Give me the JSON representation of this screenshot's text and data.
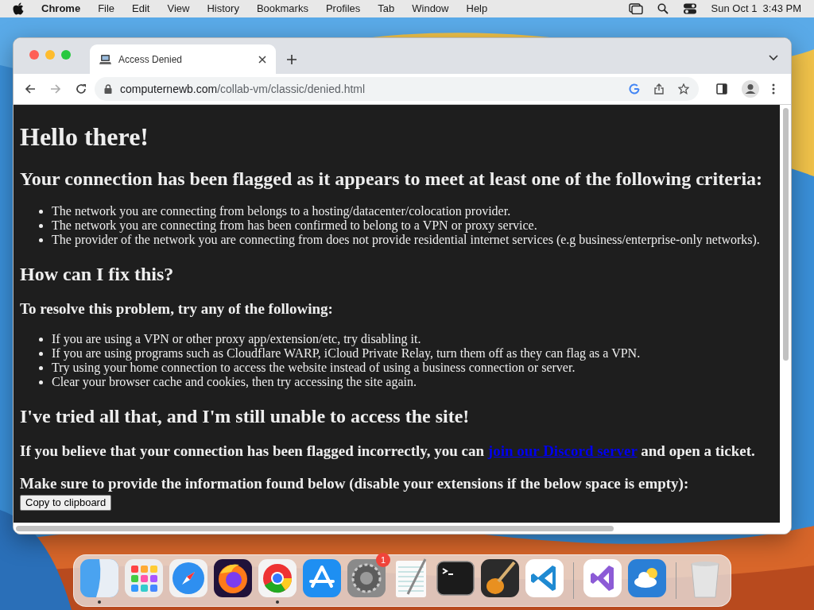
{
  "menu_bar": {
    "app": "Chrome",
    "items": [
      "File",
      "Edit",
      "View",
      "History",
      "Bookmarks",
      "Profiles",
      "Tab",
      "Window",
      "Help"
    ],
    "clock": "Sun Oct 1  3:43 PM"
  },
  "tabs": [
    {
      "title": "Access Denied",
      "selected": true
    }
  ],
  "address": {
    "host": "computernewb.com",
    "path": "/collab-vm/classic/denied.html"
  },
  "page": {
    "title": "Hello there!",
    "heading": "Your connection has been flagged as it appears to meet at least one of the following criteria:",
    "criteria": [
      "The network you are connecting from belongs to a hosting/datacenter/colocation provider.",
      "The network you are connecting from has been confirmed to belong to a VPN or proxy service.",
      "The provider of the network you are connecting from does not provide residential internet services (e.g business/enterprise-only networks)."
    ],
    "fix_heading": "How can I fix this?",
    "fix_intro": "To resolve this problem, try any of the following:",
    "fixes": [
      "If you are using a VPN or other proxy app/extension/etc, try disabling it.",
      "If you are using programs such as Cloudflare WARP, iCloud Private Relay, turn them off as they can flag as a VPN.",
      "Try using your home connection to access the website instead of using a business connection or server.",
      "Clear your browser cache and cookies, then try accessing the site again."
    ],
    "still_heading": "I've tried all that, and I'm still unable to access the site!",
    "contact_before": "If you believe that your connection has been flagged incorrectly, you can",
    "contact_link": "join our Discord server",
    "contact_after": "and open a ticket.",
    "info_line": "Make sure to provide the information found below (disable your extensions if the below space is empty):",
    "copy_button": "Copy to clipboard"
  },
  "dock": [
    {
      "kind": "finder",
      "running": true
    },
    {
      "kind": "launchpad",
      "running": false
    },
    {
      "kind": "safari",
      "running": false
    },
    {
      "kind": "firefox",
      "running": false
    },
    {
      "kind": "chrome",
      "running": true
    },
    {
      "kind": "appstore",
      "running": false
    },
    {
      "kind": "settings",
      "running": false,
      "badge": "1"
    },
    {
      "kind": "textedit",
      "running": false
    },
    {
      "kind": "terminal",
      "running": false
    },
    {
      "kind": "garageband",
      "running": false
    },
    {
      "kind": "vscode",
      "running": false
    },
    {
      "kind": "divider"
    },
    {
      "kind": "visualstudio",
      "running": false
    },
    {
      "kind": "weather",
      "running": false
    },
    {
      "kind": "divider"
    },
    {
      "kind": "trash",
      "running": false
    }
  ]
}
